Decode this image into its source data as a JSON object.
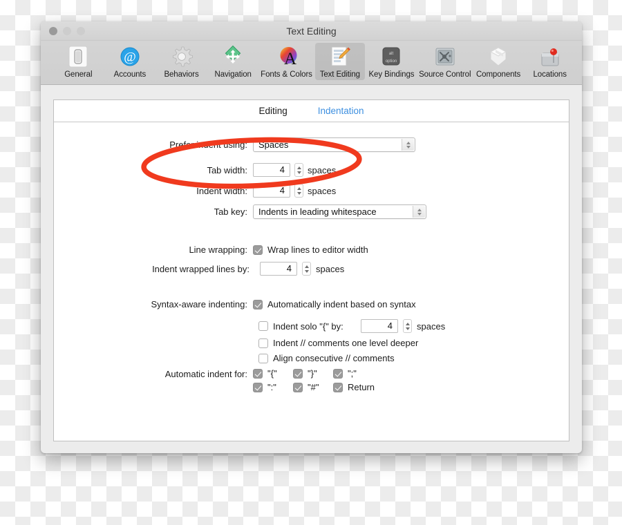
{
  "window": {
    "title": "Text Editing",
    "traffic_lights": [
      "close-button",
      "minimize-button",
      "zoom-button"
    ]
  },
  "toolbar": {
    "items": [
      {
        "label": "General",
        "icon": "device-icon",
        "selected": false
      },
      {
        "label": "Accounts",
        "icon": "at-sign-icon",
        "selected": false
      },
      {
        "label": "Behaviors",
        "icon": "gear-icon",
        "selected": false
      },
      {
        "label": "Navigation",
        "icon": "move-arrows-icon",
        "selected": false
      },
      {
        "label": "Fonts & Colors",
        "icon": "color-wheel-a-icon",
        "selected": false
      },
      {
        "label": "Text Editing",
        "icon": "pencil-page-icon",
        "selected": true
      },
      {
        "label": "Key Bindings",
        "icon": "option-key-icon",
        "selected": false
      },
      {
        "label": "Source Control",
        "icon": "safe-vault-icon",
        "selected": false
      },
      {
        "label": "Components",
        "icon": "package-box-icon",
        "selected": false
      },
      {
        "label": "Locations",
        "icon": "hard-drive-pin-icon",
        "selected": false
      }
    ]
  },
  "tabs": [
    {
      "label": "Editing",
      "active": false
    },
    {
      "label": "Indentation",
      "active": true
    }
  ],
  "form": {
    "prefer_indent": {
      "label": "Prefer indent using:",
      "value": "Spaces"
    },
    "tab_width": {
      "label": "Tab width:",
      "value": "4",
      "unit": "spaces"
    },
    "indent_width": {
      "label": "Indent width:",
      "value": "4",
      "unit": "spaces"
    },
    "tab_key": {
      "label": "Tab key:",
      "value": "Indents in leading whitespace"
    },
    "line_wrapping": {
      "label": "Line wrapping:",
      "wrap_lines": {
        "text": "Wrap lines to editor width",
        "checked": true
      },
      "indent_wrapped": {
        "text": "Indent wrapped lines by:",
        "value": "4",
        "unit": "spaces"
      }
    },
    "syntax_aware": {
      "label": "Syntax-aware indenting:",
      "auto_indent": {
        "text": "Automatically indent based on syntax",
        "checked": true
      },
      "indent_solo_brace": {
        "text": "Indent solo \"{\" by:",
        "value": "4",
        "unit": "spaces",
        "checked": false
      },
      "indent_comments": {
        "text": "Indent // comments one level deeper",
        "checked": false
      },
      "align_comments": {
        "text": "Align consecutive // comments",
        "checked": false
      }
    },
    "automatic_indent": {
      "label": "Automatic indent for:",
      "options": [
        {
          "text": "\"{\"",
          "checked": true
        },
        {
          "text": "\"}\"",
          "checked": true
        },
        {
          "text": "\";\"",
          "checked": true
        },
        {
          "text": "\":\"",
          "checked": true
        },
        {
          "text": "\"#\"",
          "checked": true
        },
        {
          "text": "Return",
          "checked": true
        }
      ]
    }
  },
  "annotation": {
    "shape": "red-ellipse-highlight",
    "color": "#F03A1E",
    "targets": [
      "Tab width",
      "Indent width"
    ]
  },
  "colors": {
    "tab_active_link": "#3d8fe0",
    "annotation_red": "#F03A1E",
    "checkbox_fill": "#9b9b9b"
  }
}
